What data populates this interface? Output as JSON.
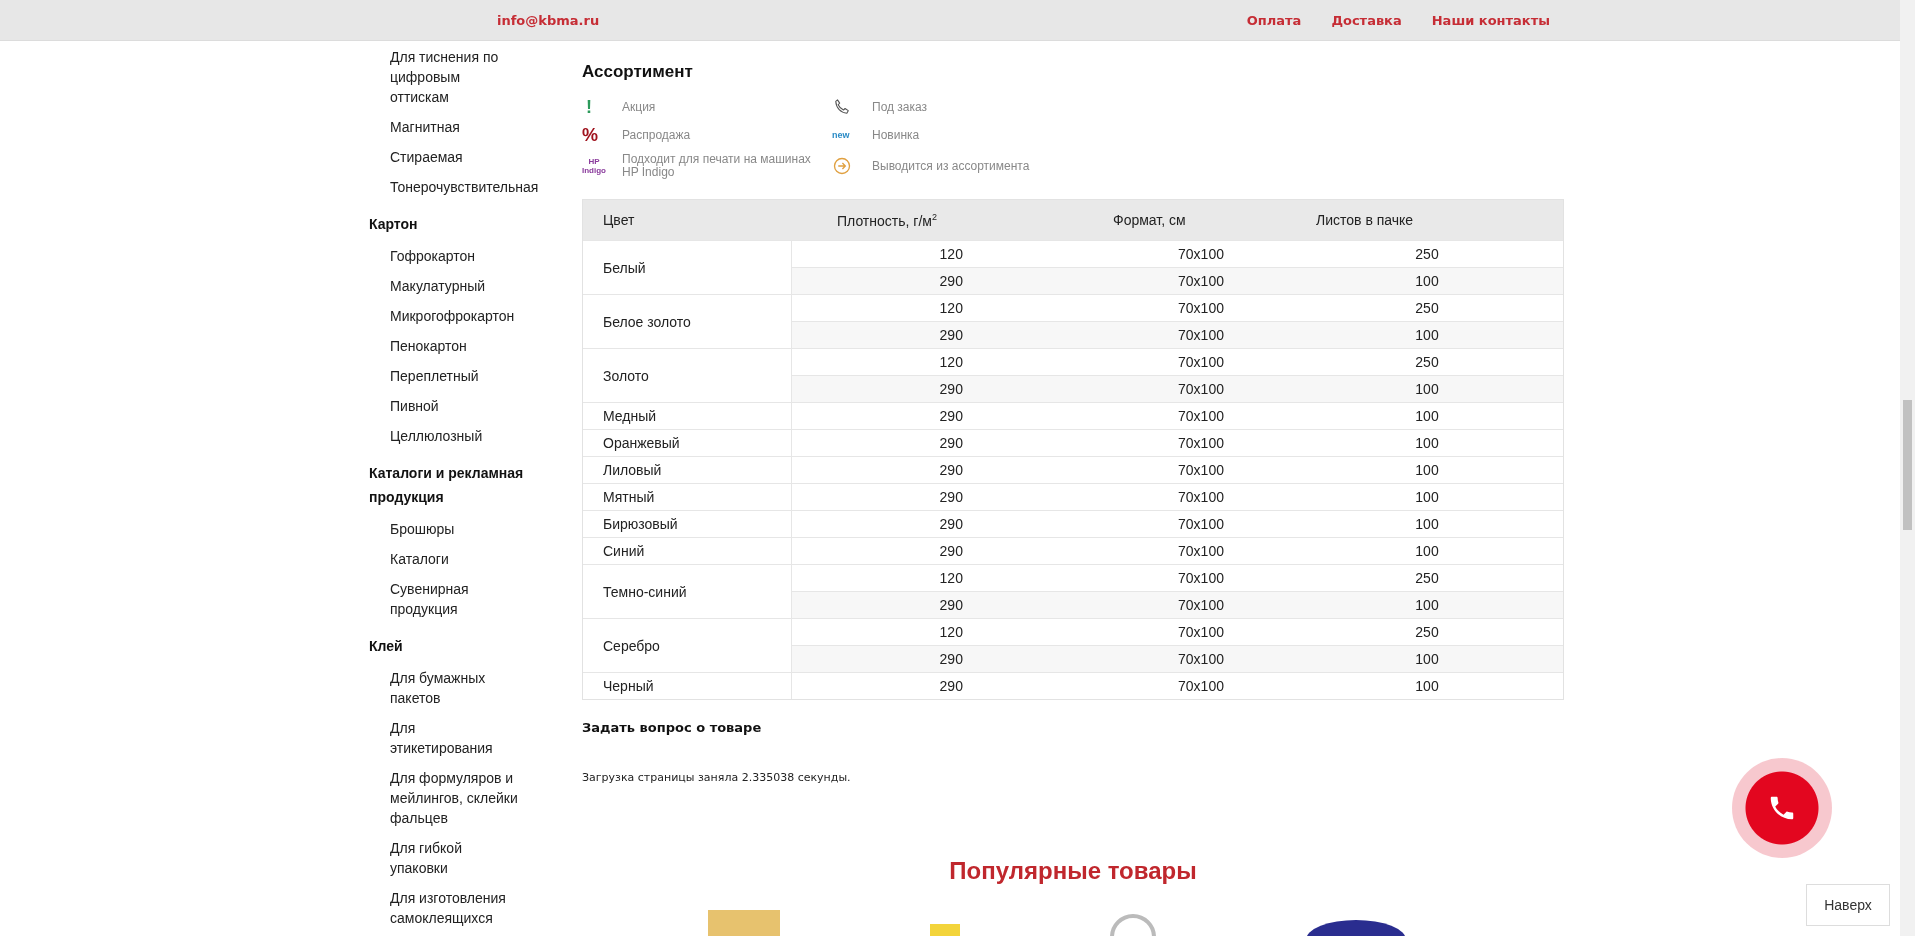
{
  "header": {
    "email": "info@kbma.ru",
    "links": [
      "Оплата",
      "Доставка",
      "Наши контакты"
    ]
  },
  "sidebar": {
    "sections": [
      {
        "items": [
          "Для тиснения по цифровым оттискам",
          "Магнитная",
          "Стираемая",
          "Тонерочувствительная"
        ]
      },
      {
        "title": "Картон",
        "items": [
          "Гофрокартон",
          "Макулатурный",
          "Микрогофрокартон",
          "Пенокартон",
          "Переплетный",
          "Пивной",
          "Целлюлозный"
        ]
      },
      {
        "title": "Каталоги и рекламная продукция",
        "items": [
          "Брошюры",
          "Каталоги",
          "Сувенирная продукция"
        ]
      },
      {
        "title": "Клей",
        "items": [
          "Для бумажных пакетов",
          "Для этикетирования",
          "Для формуляров и мейлингов, склейки фальцев",
          "Для гибкой упаковки",
          "Для изготовления самоклеящихся"
        ]
      }
    ]
  },
  "assortment": {
    "title": "Ассортимент",
    "legend": [
      {
        "kind": "exclamation",
        "mark": "!",
        "label": "Акция"
      },
      {
        "kind": "phone",
        "label": "Под заказ"
      },
      {
        "kind": "percent",
        "mark": "%",
        "label": "Распродажа"
      },
      {
        "kind": "new",
        "mark": "new",
        "label": "Новинка"
      },
      {
        "kind": "hp",
        "mark": "HP",
        "mark2": "Indigo",
        "label": "Подходит для печати на машинах HP Indigo"
      },
      {
        "kind": "arrow",
        "label": "Выводится из ассортимента"
      }
    ],
    "table": {
      "columns": [
        "Цвет",
        "Плотность, г/м$^{2}$",
        "Формат, см",
        "Листов в пачке"
      ],
      "groups": [
        {
          "color_name": "Белый",
          "rows": [
            [
              "120",
              "70x100",
              "250"
            ],
            [
              "290",
              "70x100",
              "100"
            ]
          ]
        },
        {
          "color_name": "Белое золото",
          "rows": [
            [
              "120",
              "70x100",
              "250"
            ],
            [
              "290",
              "70x100",
              "100"
            ]
          ]
        },
        {
          "color_name": "Золото",
          "rows": [
            [
              "120",
              "70x100",
              "250"
            ],
            [
              "290",
              "70x100",
              "100"
            ]
          ]
        },
        {
          "color_name": "Медный",
          "rows": [
            [
              "290",
              "70x100",
              "100"
            ]
          ]
        },
        {
          "color_name": "Оранжевый",
          "rows": [
            [
              "290",
              "70x100",
              "100"
            ]
          ]
        },
        {
          "color_name": "Лиловый",
          "rows": [
            [
              "290",
              "70x100",
              "100"
            ]
          ]
        },
        {
          "color_name": "Мятный",
          "rows": [
            [
              "290",
              "70x100",
              "100"
            ]
          ]
        },
        {
          "color_name": "Бирюзовый",
          "rows": [
            [
              "290",
              "70x100",
              "100"
            ]
          ]
        },
        {
          "color_name": "Синий",
          "rows": [
            [
              "290",
              "70x100",
              "100"
            ]
          ]
        },
        {
          "color_name": "Темно-синий",
          "rows": [
            [
              "120",
              "70x100",
              "250"
            ],
            [
              "290",
              "70x100",
              "100"
            ]
          ]
        },
        {
          "color_name": "Серебро",
          "rows": [
            [
              "120",
              "70x100",
              "250"
            ],
            [
              "290",
              "70x100",
              "100"
            ]
          ]
        },
        {
          "color_name": "Черный",
          "rows": [
            [
              "290",
              "70x100",
              "100"
            ]
          ]
        }
      ]
    }
  },
  "ask_question": "Задать вопрос о товаре",
  "load_time": "Загрузка страницы заняла 2.335038 секунды.",
  "popular": {
    "title": "Популярные товары"
  },
  "to_top": "Наверх"
}
